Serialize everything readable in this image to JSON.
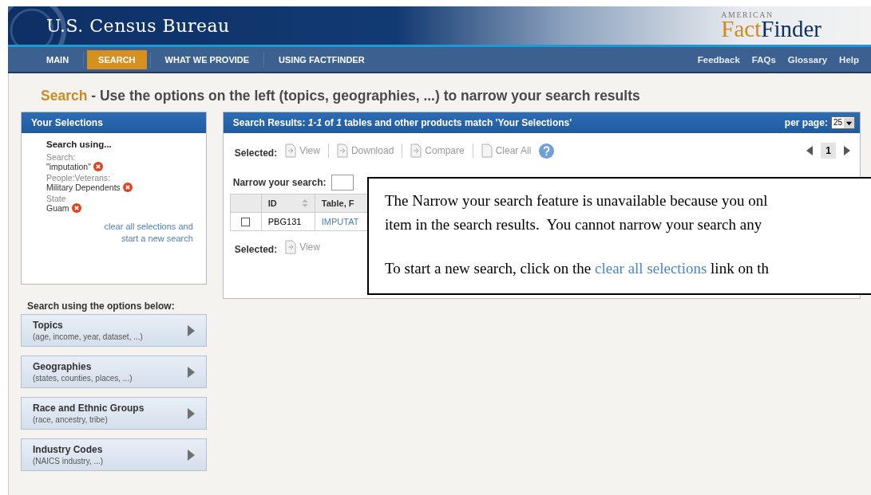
{
  "header": {
    "agency": "U.S. Census Bureau",
    "logo_top": "AMERICAN",
    "logo_first": "Fact",
    "logo_second": "Finder"
  },
  "nav": [
    {
      "label": "MAIN",
      "selected": false
    },
    {
      "label": "SEARCH",
      "selected": true
    },
    {
      "label": "WHAT WE PROVIDE",
      "selected": false
    },
    {
      "label": "USING FACTFINDER",
      "selected": false
    }
  ],
  "nav_links": [
    "Feedback",
    "FAQs",
    "Glossary",
    "Help"
  ],
  "heading": {
    "lead": "Search",
    "rest": "- Use the options on the left (topics, geographies, ...) to narrow your search results"
  },
  "selections": {
    "title": "Your Selections",
    "subtitle": "Search using...",
    "groups": [
      {
        "label": "Search:",
        "value": "\"imputation\""
      },
      {
        "label": "People:Veterans:",
        "value": "Military Dependents"
      },
      {
        "label": "State",
        "value": "Guam"
      }
    ],
    "clear_link": "clear all selections and start a new search"
  },
  "options_title": "Search using the options below:",
  "options": [
    {
      "title": "Topics",
      "subtitle": "(age, income, year, dataset, ...)"
    },
    {
      "title": "Geographies",
      "subtitle": "(states, counties, places, ...)"
    },
    {
      "title": "Race and Ethnic Groups",
      "subtitle": "(race, ancestry, tribe)"
    },
    {
      "title": "Industry Codes",
      "subtitle": "(NAICS industry, ...)"
    }
  ],
  "results": {
    "title": "Search Results: *1-1* of *1* tables and other products match 'Your Selections'",
    "per_page_label": "per page:",
    "per_page": "25",
    "toolbar_label": "Selected:",
    "actions": [
      "View",
      "Download",
      "Compare",
      "Clear All"
    ],
    "page": "1",
    "narrow_label": "Narrow your search:",
    "columns": [
      "ID",
      "Table, F"
    ],
    "rows": [
      {
        "checked": false,
        "id": "PBG131",
        "title": "IMPUTAT"
      }
    ],
    "bottom_label": "Selected:",
    "bottom_actions": [
      "View"
    ]
  },
  "popup": {
    "lines": [
      "The Narrow your search feature is unavailable because you onl",
      "item in the search results.  You cannot narrow your search any"
    ],
    "before_link": "To start a new search, click on the",
    "link": "clear all selections",
    "after_link": "link on th"
  }
}
